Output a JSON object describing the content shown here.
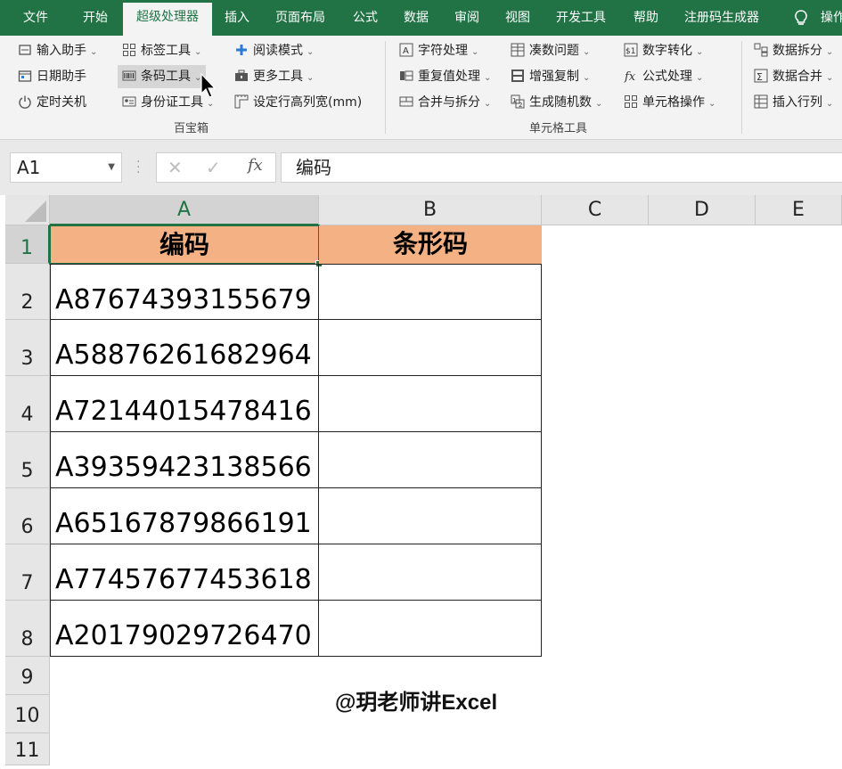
{
  "ribbon_tabs": [
    "文件",
    "开始",
    "超级处理器",
    "插入",
    "页面布局",
    "公式",
    "数据",
    "审阅",
    "视图",
    "开发工具",
    "帮助",
    "注册码生成器",
    "操作"
  ],
  "active_tab": "超级处理器",
  "ribbon": {
    "group1": {
      "label": "百宝箱",
      "items": [
        {
          "label": "输入助手",
          "icon": "input-helper-icon"
        },
        {
          "label": "日期助手",
          "icon": "calendar-icon"
        },
        {
          "label": "定时关机",
          "icon": "power-icon"
        },
        {
          "label": "标签工具",
          "icon": "label-icon"
        },
        {
          "label": "条码工具",
          "icon": "barcode-icon"
        },
        {
          "label": "身份证工具",
          "icon": "id-card-icon"
        },
        {
          "label": "阅读模式",
          "icon": "plus-icon"
        },
        {
          "label": "更多工具",
          "icon": "toolbox-icon"
        },
        {
          "label": "设定行高列宽(mm)",
          "icon": "ruler-icon"
        }
      ]
    },
    "group2": {
      "label": "单元格工具",
      "items": [
        {
          "label": "字符处理",
          "icon": "text-icon"
        },
        {
          "label": "重复值处理",
          "icon": "duplicate-icon"
        },
        {
          "label": "合并与拆分",
          "icon": "merge-icon"
        },
        {
          "label": "凑数问题",
          "icon": "sum-icon"
        },
        {
          "label": "增强复制",
          "icon": "copy-icon"
        },
        {
          "label": "生成随机数",
          "icon": "random-icon"
        },
        {
          "label": "数字转化",
          "icon": "convert-icon"
        },
        {
          "label": "公式处理",
          "icon": "formula-icon"
        },
        {
          "label": "单元格操作",
          "icon": "cell-icon"
        }
      ]
    },
    "group3": {
      "items": [
        {
          "label": "数据拆分",
          "icon": "split-icon"
        },
        {
          "label": "数据合并",
          "icon": "sigma-icon"
        },
        {
          "label": "插入行列",
          "icon": "insert-icon"
        }
      ]
    }
  },
  "formula_bar": {
    "name_box": "A1",
    "formula": "编码",
    "fx": "fx"
  },
  "columns": [
    "A",
    "B",
    "C",
    "D",
    "E"
  ],
  "rows": [
    "1",
    "2",
    "3",
    "4",
    "5",
    "6",
    "7",
    "8",
    "9",
    "10",
    "11"
  ],
  "sheet": {
    "header_a": "编码",
    "header_b": "条形码",
    "codes": [
      "A87674393155679",
      "A58876261682964",
      "A72144015478416",
      "A39359423138566",
      "A65167879866191",
      "A77457677453618",
      "A20179029726470"
    ]
  },
  "watermark": "@玥老师讲Excel",
  "colors": {
    "ribbon_green": "#217346",
    "header_fill": "#f4b183"
  }
}
